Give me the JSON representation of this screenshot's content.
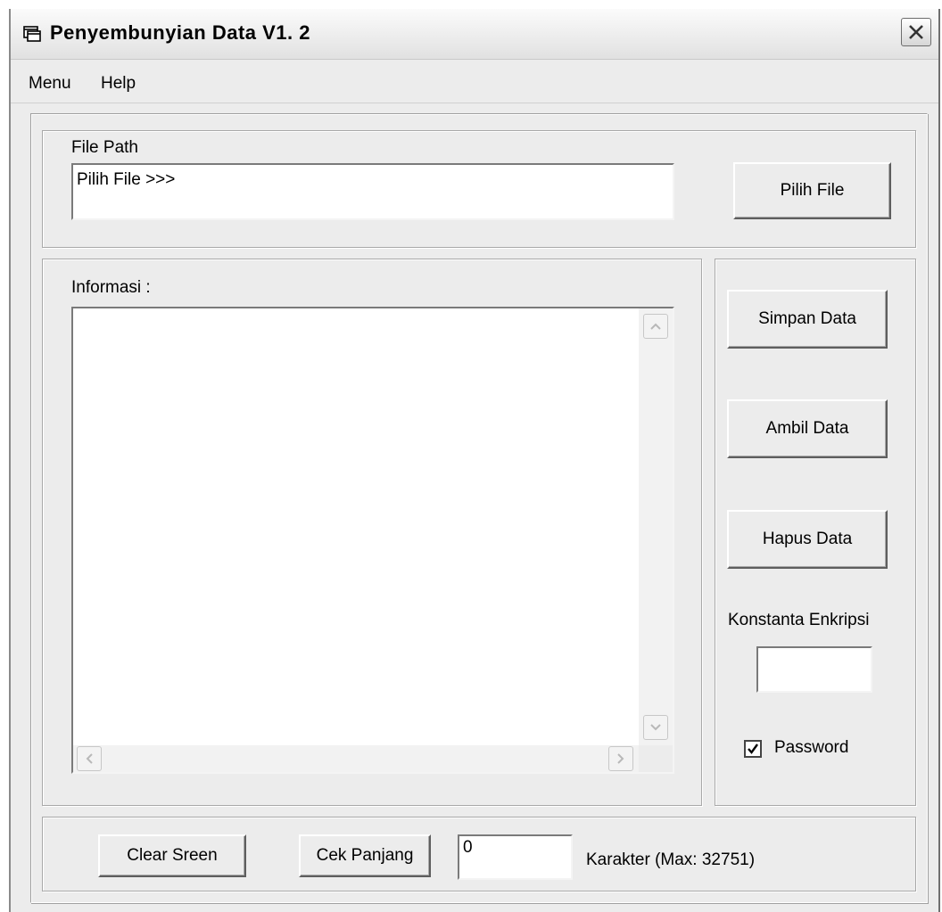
{
  "window": {
    "title": "Penyembunyian Data V1. 2",
    "icon": "app-window-icon",
    "close_icon": "close-icon"
  },
  "menubar": {
    "items": [
      {
        "label": "Menu"
      },
      {
        "label": "Help"
      }
    ]
  },
  "file_path": {
    "label": "File Path",
    "value": "Pilih File >>>",
    "browse_button": "Pilih File"
  },
  "info": {
    "label": "Informasi :",
    "content": ""
  },
  "actions": {
    "save_button": "Simpan Data",
    "get_button": "Ambil Data",
    "delete_button": "Hapus Data",
    "key_label": "Konstanta Enkripsi",
    "key_value": "",
    "password_label": "Password",
    "password_checked": true
  },
  "bottom": {
    "clear_button": "Clear Sreen",
    "check_length_button": "Cek Panjang",
    "length_value": "0",
    "length_caption": "Karakter (Max: 32751)"
  }
}
